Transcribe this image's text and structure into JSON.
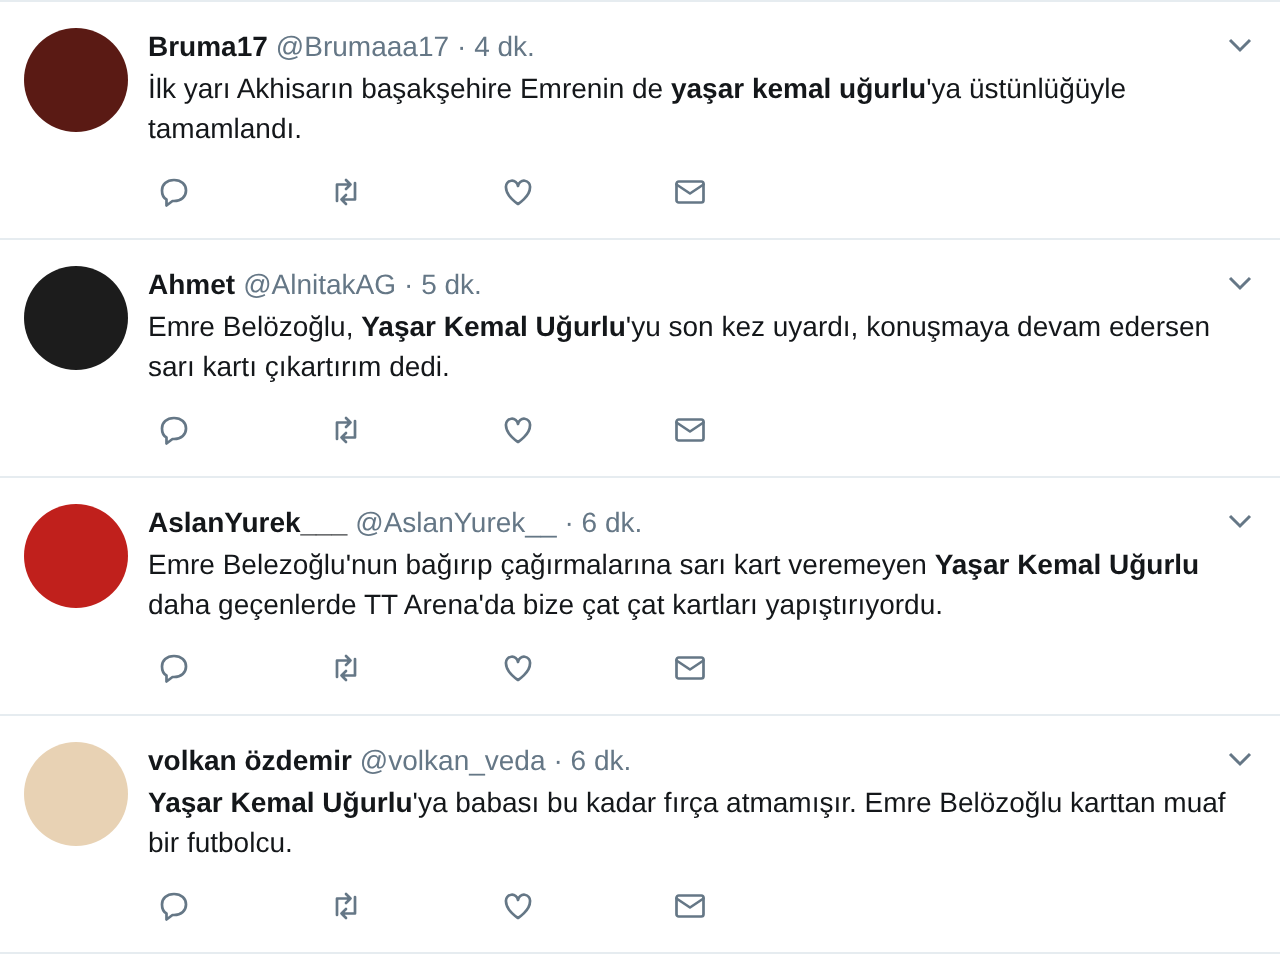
{
  "tweets": [
    {
      "name": "Bruma17",
      "handle": "@Brumaaa17",
      "time": "· 4 dk.",
      "text": "İlk yarı Akhisarın başakşehire Emrenin de **yaşar kemal uğurlu**'ya üstünlüğüyle tamamlandı."
    },
    {
      "name": "Ahmet",
      "handle": "@AlnitakAG",
      "time": "· 5 dk.",
      "text": "Emre Belözoğlu, **Yaşar Kemal Uğurlu**'yu son kez uyardı, konuşmaya devam edersen sarı kartı çıkartırım dedi."
    },
    {
      "name": "AslanYurek___",
      "handle": "@AslanYurek__",
      "time": "· 6 dk.",
      "text": "Emre Belezoğlu'nun bağırıp çağırmalarına sarı kart veremeyen **Yaşar Kemal Uğurlu** daha geçenlerde TT Arena'da bize çat çat kartları yapıştırıyordu."
    },
    {
      "name": "volkan özdemir",
      "handle": "@volkan_veda",
      "time": "· 6 dk.",
      "text": "**Yaşar Kemal Uğurlu**'ya babası bu kadar fırça atmamışır. Emre Belözoğlu karttan muaf bir futbolcu."
    }
  ]
}
